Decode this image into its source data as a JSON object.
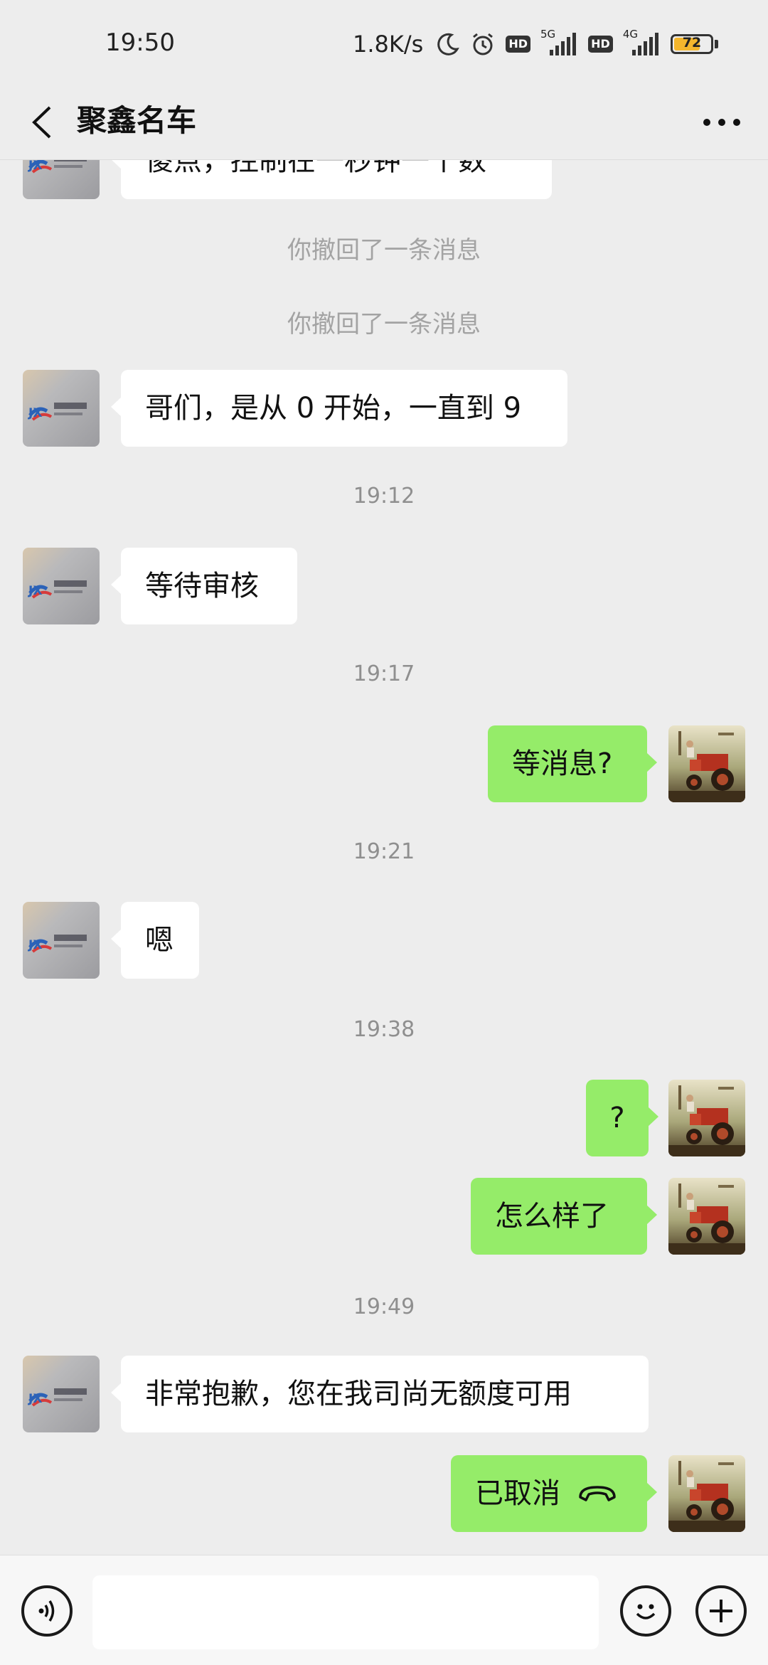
{
  "status_bar": {
    "time": "19:50",
    "net_speed": "1.8K/s",
    "icons": [
      "moon-icon",
      "alarm-icon",
      "hd-icon",
      "signal-5g-icon",
      "hd-icon",
      "signal-4g-icon",
      "battery-icon"
    ],
    "hd_label": "HD",
    "net1_label": "5G",
    "net2_label": "4G",
    "battery_level": "72",
    "battery_color": "#f4b62d"
  },
  "header": {
    "title": "聚鑫名车",
    "back_icon": "chevron-left-icon",
    "more_icon": "more-dots-icon"
  },
  "messages": {
    "m0_text": "傻点，控制在一秒钟一个数",
    "sys1": "你撤回了一条消息",
    "sys2": "你撤回了一条消息",
    "m1_text": "哥们，是从 0 开始，一直到 9",
    "t1": "19:12",
    "m2_text": "等待审核",
    "t2": "19:17",
    "m3_text": "等消息?",
    "t3": "19:21",
    "m4_text": "嗯",
    "t4": "19:38",
    "m5_text": "?",
    "m6_text": "怎么样了",
    "t5": "19:49",
    "m7_text": "非常抱歉，您在我司尚无额度可用",
    "m8_text": "已取消",
    "m8_icon": "hangup-phone-icon"
  },
  "input_bar": {
    "voice_icon": "voice-icon",
    "emoji_icon": "emoji-icon",
    "plus_icon": "plus-icon",
    "input_value": ""
  },
  "colors": {
    "background": "#ededed",
    "sent_bubble": "#95ec69",
    "received_bubble": "#ffffff"
  }
}
